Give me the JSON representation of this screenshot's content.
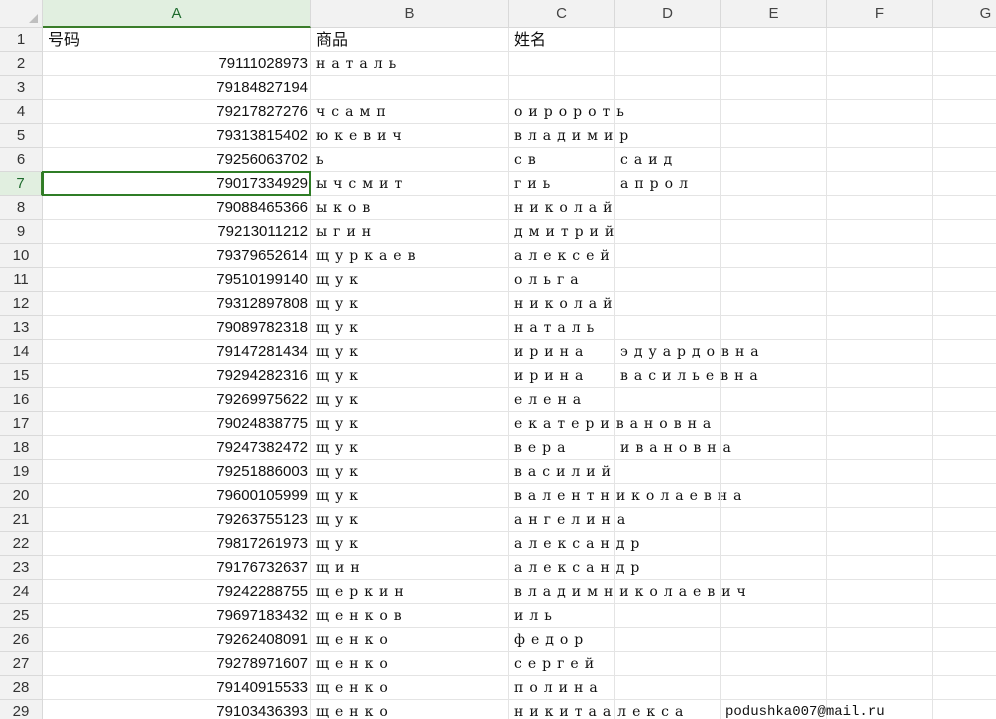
{
  "columns": [
    "A",
    "B",
    "C",
    "D",
    "E",
    "F",
    "G"
  ],
  "corner_icon": "select-all-triangle-icon",
  "header_row": {
    "row": "1",
    "a": "号码",
    "b": "商品",
    "c": "姓名"
  },
  "selected": {
    "row": "7",
    "column": "A"
  },
  "accent_color": "#2f7d26",
  "rows": [
    {
      "row": "2",
      "a": "79111028973",
      "b": "наталь",
      "c": "",
      "d": ""
    },
    {
      "row": "3",
      "a": "79184827194",
      "b": "",
      "c": "",
      "d": ""
    },
    {
      "row": "4",
      "a": "79217827276",
      "b": "чсамп",
      "c": "оиророть",
      "d": ""
    },
    {
      "row": "5",
      "a": "79313815402",
      "b": "юкевич",
      "c": "владимир",
      "d": ""
    },
    {
      "row": "6",
      "a": "79256063702",
      "b": "ь",
      "c": "св",
      "d": "саид"
    },
    {
      "row": "7",
      "a": "79017334929",
      "b": "ычсмит",
      "c": "гиь",
      "d": "апрол"
    },
    {
      "row": "8",
      "a": "79088465366",
      "b": "ыков",
      "c": "николай",
      "d": ""
    },
    {
      "row": "9",
      "a": "79213011212",
      "b": "ыгин",
      "c": "дмитрий",
      "d": ""
    },
    {
      "row": "10",
      "a": "79379652614",
      "b": "щуркаев",
      "c": "алексей",
      "d": ""
    },
    {
      "row": "11",
      "a": "79510199140",
      "b": "щук",
      "c": "ольга",
      "d": ""
    },
    {
      "row": "12",
      "a": "79312897808",
      "b": "щук",
      "c": "николай",
      "d": ""
    },
    {
      "row": "13",
      "a": "79089782318",
      "b": "щук",
      "c": "наталь",
      "d": ""
    },
    {
      "row": "14",
      "a": "79147281434",
      "b": "щук",
      "c": "ирина",
      "d": "эдуардовна"
    },
    {
      "row": "15",
      "a": "79294282316",
      "b": "щук",
      "c": "ирина",
      "d": "васильевна"
    },
    {
      "row": "16",
      "a": "79269975622",
      "b": "щук",
      "c": "елена",
      "d": ""
    },
    {
      "row": "17",
      "a": "79024838775",
      "b": "щук",
      "c": "екатеривановна",
      "d": ""
    },
    {
      "row": "18",
      "a": "79247382472",
      "b": "щук",
      "c": "вера",
      "d": "ивановна"
    },
    {
      "row": "19",
      "a": "79251886003",
      "b": "щук",
      "c": "василий",
      "d": ""
    },
    {
      "row": "20",
      "a": "79600105999",
      "b": "щук",
      "c": "валентниколаевна",
      "d": ""
    },
    {
      "row": "21",
      "a": "79263755123",
      "b": "щук",
      "c": "ангелина",
      "d": ""
    },
    {
      "row": "22",
      "a": "79817261973",
      "b": "щук",
      "c": "александр",
      "d": ""
    },
    {
      "row": "23",
      "a": "79176732637",
      "b": "щин",
      "c": "александр",
      "d": ""
    },
    {
      "row": "24",
      "a": "79242288755",
      "b": "щеркин",
      "c": "владимниколаевич",
      "d": ""
    },
    {
      "row": "25",
      "a": "79697183432",
      "b": "щенков",
      "c": "иль",
      "d": ""
    },
    {
      "row": "26",
      "a": "79262408091",
      "b": "щенко",
      "c": "федор",
      "d": ""
    },
    {
      "row": "27",
      "a": "79278971607",
      "b": "щенко",
      "c": "сергей",
      "d": ""
    },
    {
      "row": "28",
      "a": "79140915533",
      "b": "щенко",
      "c": "полина",
      "d": ""
    },
    {
      "row": "29",
      "a": "79103436393",
      "b": "щенко",
      "c": "никитаалекса",
      "d": "",
      "e": "podushka007@mail.ru"
    }
  ]
}
